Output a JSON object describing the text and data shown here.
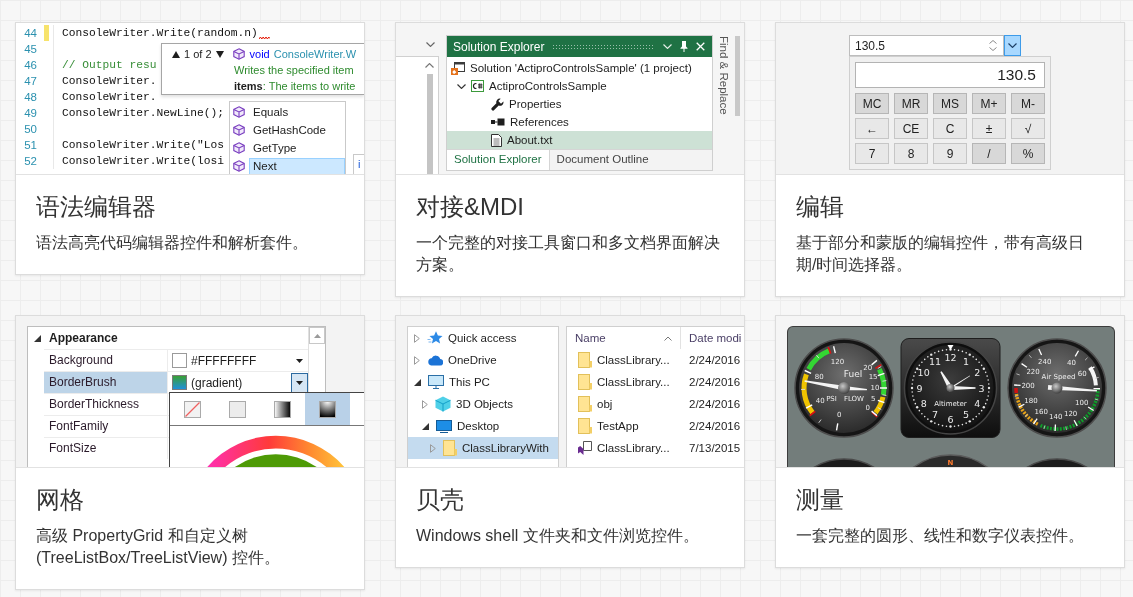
{
  "cards": [
    {
      "kind": "syntax_editor",
      "title": "语法编辑器",
      "description": "语法高亮代码编辑器控件和解析套件。",
      "preview": {
        "lines": [
          {
            "number": "44",
            "kind": "code",
            "text": "ConsoleWriter.Write(random.n)",
            "modified": true,
            "error": true
          },
          {
            "number": "45",
            "kind": "blank",
            "modified": false,
            "error": false
          },
          {
            "number": "46",
            "kind": "comment",
            "text": "// Output resu",
            "modified": false,
            "error": false
          },
          {
            "number": "47",
            "kind": "code",
            "text": "ConsoleWriter.",
            "modified": false,
            "error": false
          },
          {
            "number": "48",
            "kind": "code",
            "text": "ConsoleWriter.",
            "modified": false,
            "error": false
          },
          {
            "number": "49",
            "kind": "code",
            "text": "ConsoleWriter.NewLine();",
            "modified": false,
            "error": false
          },
          {
            "number": "50",
            "kind": "blank",
            "modified": false,
            "error": false
          },
          {
            "number": "51",
            "kind": "code",
            "text": "ConsoleWriter.Write(\"Los",
            "modified": false,
            "error": false
          },
          {
            "number": "52",
            "kind": "code",
            "text": "ConsoleWriter.Write(losi",
            "modified": false,
            "error": false
          }
        ],
        "parameter_info": {
          "counter": "1 of 2",
          "keyword": "void",
          "signature": "ConsoleWriter.W",
          "summary": "Writes the specified item",
          "parameter": "**items**: The items to write"
        },
        "completions": [
          {
            "label": "Equals",
            "selected": false
          },
          {
            "label": "GetHashCode",
            "selected": false
          },
          {
            "label": "GetType",
            "selected": false
          },
          {
            "label": "Next",
            "selected": true
          }
        ],
        "quick_info": "i"
      }
    },
    {
      "kind": "docking",
      "title": "对接&MDI",
      "description": "一个完整的对接工具窗口和多文档界面解决方案。",
      "preview": {
        "tool_window": {
          "title": "Solution Explorer",
          "tree": [
            {
              "kind": "solution",
              "label": "Solution 'ActiproControlsSample' (1 project)",
              "selected": false,
              "children": [
                {
                  "kind": "project",
                  "label": "ActiproControlsSample",
                  "expanded": true,
                  "selected": false,
                  "children": [
                    {
                      "kind": "properties",
                      "label": "Properties",
                      "selected": false
                    },
                    {
                      "kind": "references",
                      "label": "References",
                      "selected": false
                    },
                    {
                      "kind": "file",
                      "label": "About.txt",
                      "selected": true
                    }
                  ]
                }
              ]
            }
          ],
          "tabs": [
            {
              "label": "Solution Explorer",
              "selected": true
            },
            {
              "label": "Document Outline",
              "selected": false
            }
          ]
        },
        "side_tab": "Find & Replace"
      }
    },
    {
      "kind": "editors",
      "title": "编辑",
      "description": "基于部分和蒙版的编辑控件，带有高级日期/时间选择器。",
      "preview": {
        "value": "130.5",
        "dropdown_open": true,
        "display": "130.5",
        "keys": [
          {
            "label": "MC",
            "kind": "memory"
          },
          {
            "label": "MR",
            "kind": "memory"
          },
          {
            "label": "MS",
            "kind": "memory"
          },
          {
            "label": "M+",
            "kind": "memory"
          },
          {
            "label": "M-",
            "kind": "memory"
          },
          {
            "label": "←",
            "kind": "edit"
          },
          {
            "label": "CE",
            "kind": "edit"
          },
          {
            "label": "C",
            "kind": "edit"
          },
          {
            "label": "±",
            "kind": "edit"
          },
          {
            "label": "√",
            "kind": "edit"
          },
          {
            "label": "7",
            "kind": "digit"
          },
          {
            "label": "8",
            "kind": "digit"
          },
          {
            "label": "9",
            "kind": "digit"
          },
          {
            "label": "/",
            "kind": "operator"
          },
          {
            "label": "%",
            "kind": "operator"
          }
        ]
      }
    },
    {
      "kind": "grids",
      "title": "网格",
      "description": "高级 PropertyGrid 和自定义树 (TreeListBox/TreeListView) 控件。",
      "preview": {
        "category": {
          "label": "Appearance",
          "expanded": true
        },
        "properties": [
          {
            "name": "Background",
            "kind": "solid",
            "value": "#FFFFFFFF",
            "selected": false,
            "open": false
          },
          {
            "name": "BorderBrush",
            "kind": "gradient",
            "value": "(gradient)",
            "selected": true,
            "open": true
          },
          {
            "name": "BorderThickness",
            "kind": "empty",
            "selected": false
          },
          {
            "name": "FontFamily",
            "kind": "empty",
            "selected": false
          },
          {
            "name": "FontSize",
            "kind": "empty",
            "selected": false
          }
        ],
        "brush_types": [
          {
            "kind": "none",
            "selected": false
          },
          {
            "kind": "solid",
            "selected": false
          },
          {
            "kind": "linear",
            "selected": false
          },
          {
            "kind": "radial",
            "selected": true
          }
        ]
      }
    },
    {
      "kind": "shell",
      "title": "贝壳",
      "description": "Windows shell 文件夹和文件浏览控件。",
      "preview": {
        "nav": [
          {
            "kind": "quick_access",
            "label": "Quick access",
            "expanded": false,
            "selected": false
          },
          {
            "kind": "cloud",
            "label": "OneDrive",
            "expanded": false,
            "selected": false
          },
          {
            "kind": "computer",
            "label": "This PC",
            "expanded": true,
            "selected": false,
            "children": [
              {
                "kind": "cube",
                "label": "3D Objects",
                "expanded": false,
                "selected": false
              },
              {
                "kind": "desktop",
                "label": "Desktop",
                "expanded": true,
                "selected": false,
                "children": [
                  {
                    "kind": "folder",
                    "label": "ClassLibraryWith",
                    "expanded": false,
                    "selected": true
                  }
                ]
              }
            ]
          }
        ],
        "columns": [
          {
            "label": "Name",
            "sorted": true
          },
          {
            "label": "Date modi",
            "sorted": false
          }
        ],
        "files": [
          {
            "kind": "folder",
            "name": "ClassLibrary...",
            "date": "2/24/2016"
          },
          {
            "kind": "folder",
            "name": "ClassLibrary...",
            "date": "2/24/2016"
          },
          {
            "kind": "folder",
            "name": "obj",
            "date": "2/24/2016"
          },
          {
            "kind": "folder",
            "name": "TestApp",
            "date": "2/24/2016"
          },
          {
            "kind": "solution",
            "name": "ClassLibrary...",
            "date": "7/13/2015"
          }
        ]
      }
    },
    {
      "kind": "gauges",
      "title": "测量",
      "description": "一套完整的圆形、线性和数字仪表控件。",
      "preview": {
        "gauges": [
          {
            "kind": "dual",
            "title": "Fuel",
            "scales": [
              {
                "label": "PSI",
                "ticks": [
                  "120",
                  "80",
                  "40",
                  "0"
                ]
              },
              {
                "label": "FLOW",
                "ticks": [
                  "20",
                  "15",
                  "10",
                  "5",
                  "0"
                ]
              }
            ]
          },
          {
            "kind": "clock",
            "title": "Altimeter",
            "ticks": [
              "12",
              "1",
              "2",
              "3",
              "4",
              "5",
              "11",
              "10",
              "9",
              "8",
              "7",
              "6"
            ]
          },
          {
            "kind": "dial",
            "title": "Air Speed",
            "ticks": [
              "40",
              "60",
              "100",
              "120",
              "240",
              "220",
              "200",
              "180",
              "160",
              "140"
            ]
          }
        ],
        "lower_gauges": [
          {
            "kind": "round"
          },
          {
            "kind": "compass",
            "label": "N"
          },
          {
            "kind": "round"
          }
        ]
      }
    }
  ]
}
